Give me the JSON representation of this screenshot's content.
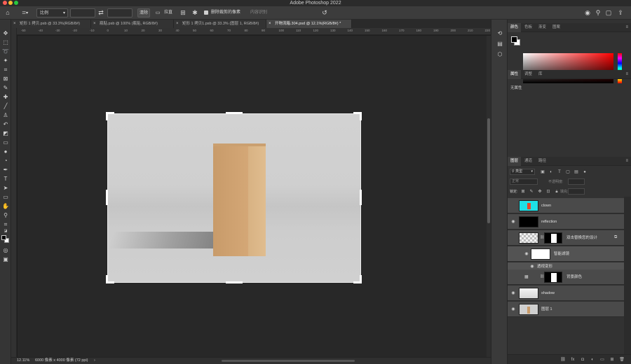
{
  "window": {
    "title": "Adobe Photoshop 2022"
  },
  "options_bar": {
    "ratio_label": "比例",
    "clear_label": "清除",
    "straighten_label": "拉直",
    "delete_cropped_label": "删除裁剪的像素",
    "content_aware_label": "内容识别"
  },
  "doc_tabs": [
    {
      "label": "矩形 1 拷贝.psb @ 33.3%(RGB/8#)",
      "active": false
    },
    {
      "label": "瓶贴.psb @ 100% (瓶贴, RGB/8#)",
      "active": false
    },
    {
      "label": "矩形 1 拷贝1.psb @ 33.3% (图层 1, RGB/8#)",
      "active": false
    },
    {
      "label": "开物流箱.304.psd @ 12.1%(RGB/8#) *",
      "active": true
    }
  ],
  "ruler_ticks": [
    "-50",
    "-40",
    "-30",
    "-20",
    "-10",
    "0",
    "10",
    "20",
    "30",
    "40",
    "50",
    "60",
    "70",
    "80",
    "90",
    "100",
    "110",
    "120",
    "130",
    "140",
    "150",
    "160",
    "170",
    "180",
    "190",
    "200",
    "210",
    "220"
  ],
  "status_bar": {
    "zoom": "12.11%",
    "doc_info": "6000 像素 x 4000 像素 (72 ppi)"
  },
  "color_panel": {
    "tabs": [
      "颜色",
      "色板",
      "渐变",
      "图案"
    ],
    "foreground": "#000000",
    "background": "#ffffff"
  },
  "properties_panel": {
    "tabs": [
      "属性",
      "调整",
      "库"
    ],
    "empty_text": "无属性"
  },
  "layers_panel": {
    "tabs": [
      "图层",
      "通道",
      "路径"
    ],
    "filter_kind": "类型",
    "blend_mode": "正常",
    "opacity_label": "不透明度:",
    "lock_label": "锁定:",
    "fill_label": "填充:",
    "layers": [
      {
        "name": "clown",
        "visible": false,
        "thumb": "cyan"
      },
      {
        "name": "reflection",
        "visible": true,
        "thumb": "black"
      },
      {
        "name": "双击替换您的设计",
        "visible": false,
        "thumb": "checker-smart"
      },
      {
        "name": "智能滤镜",
        "visible": true,
        "thumb": "white",
        "sub": true
      },
      {
        "name": "透视变形",
        "visible": true,
        "thumb": "none",
        "sub": true
      },
      {
        "name": "背景颜色",
        "visible": false,
        "thumb": "mask"
      },
      {
        "name": "shadow",
        "visible": true,
        "thumb": "shadow"
      },
      {
        "name": "图层 1",
        "visible": true,
        "thumb": "photo"
      }
    ]
  }
}
